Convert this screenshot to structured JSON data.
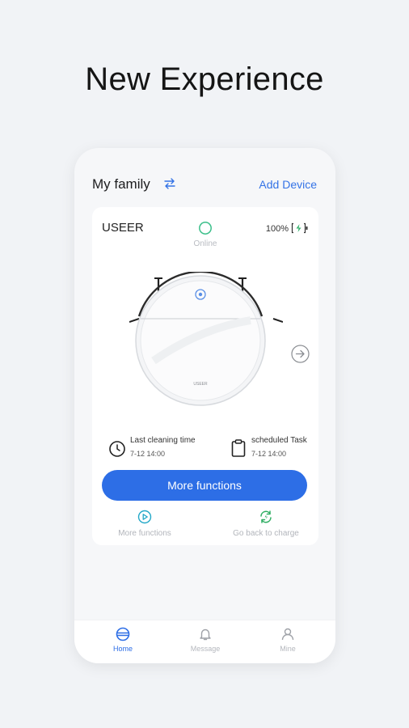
{
  "headline": "New Experience",
  "header": {
    "family_name": "My family",
    "add_device": "Add Device"
  },
  "device": {
    "name": "USEER",
    "status": "Online",
    "battery": "100%",
    "brand_mark": "USEER"
  },
  "info": {
    "last_cleaning_label": "Last cleaning time",
    "last_cleaning_time": "7-12 14:00",
    "scheduled_label": "scheduled Task",
    "scheduled_time": "7-12 14:00"
  },
  "buttons": {
    "more_functions": "More functions"
  },
  "actions": [
    {
      "label": "More functions",
      "icon": "play-icon"
    },
    {
      "label": "Go back to charge",
      "icon": "recharge-icon"
    }
  ],
  "nav": [
    {
      "label": "Home",
      "icon": "robot-home-icon",
      "active": true
    },
    {
      "label": "Message",
      "icon": "bell-icon",
      "active": false
    },
    {
      "label": "Mine",
      "icon": "person-icon",
      "active": false
    }
  ],
  "colors": {
    "accent": "#2d6ee6",
    "online": "#3bbf8a",
    "battery": "#35b36e",
    "play": "#22a8c8",
    "recharge": "#2fae63"
  }
}
